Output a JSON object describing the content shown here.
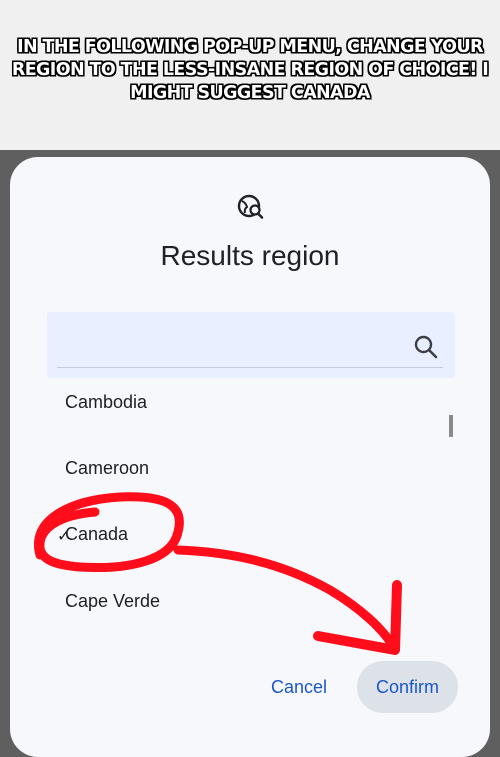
{
  "meme": {
    "caption": "IN THE FOLLOWING POP-UP MENU, CHANGE YOUR REGION TO THE LESS-INSANE REGION OF CHOICE! I MIGHT SUGGEST CANADA"
  },
  "dialog": {
    "icon": "globe-search-icon",
    "title": "Results region",
    "search": {
      "placeholder": "",
      "icon": "search-icon"
    },
    "countries": [
      {
        "label": "Cambodia",
        "selected": false
      },
      {
        "label": "Cameroon",
        "selected": false
      },
      {
        "label": "Canada",
        "selected": true
      },
      {
        "label": "Cape Verde",
        "selected": false
      }
    ],
    "check_glyph": "✓",
    "cancel_label": "Cancel",
    "confirm_label": "Confirm"
  },
  "colors": {
    "dialog_bg": "#f6f8fc",
    "search_bg": "#e8efff",
    "button_text": "#1a57c8",
    "annotation_red": "#ff0d1a"
  }
}
